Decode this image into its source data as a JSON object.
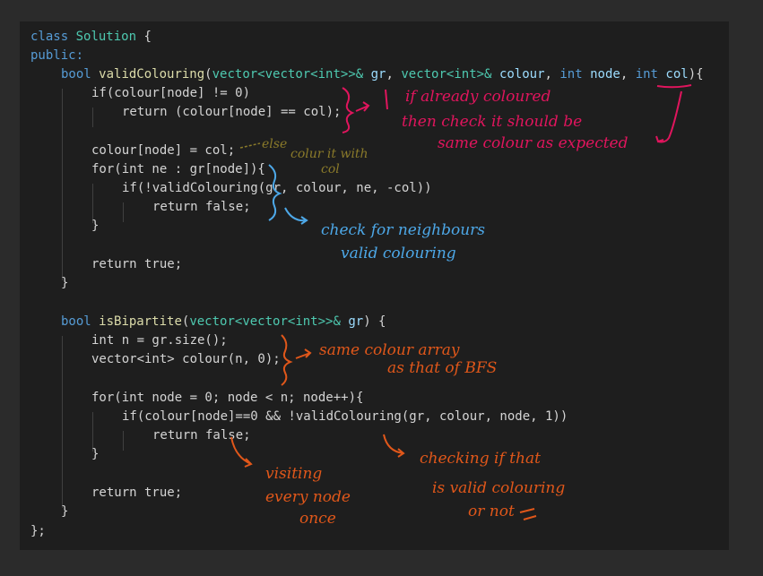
{
  "code": {
    "class_kw": "class",
    "class_name": "Solution",
    "public_label": "public:",
    "valid": {
      "ret_type": "bool",
      "name": "validColouring",
      "params": [
        {
          "type": "vector<vector<int>>&",
          "name": "gr"
        },
        {
          "type": "vector<int>&",
          "name": "colour"
        },
        {
          "type": "int",
          "name": "node"
        },
        {
          "type": "int",
          "name": "col"
        }
      ],
      "if_line": "if(colour[node] != 0)",
      "return_line": "return (colour[node] == col);",
      "assign_line": "colour[node] = col;",
      "for_line": "for(int ne : gr[node]){",
      "inner_if": "if(!validColouring(gr, colour, ne, -col))",
      "inner_return": "return false;",
      "final_return": "return true;"
    },
    "bip": {
      "ret_type": "bool",
      "name": "isBipartite",
      "decl_n": "int n = gr.size();",
      "decl_vec": "vector<int> colour(n, 0);",
      "for_line": "for(int node = 0; node < n; node++){",
      "inner_if": "if(colour[node]==0 && !validColouring(gr, colour, node, 1))",
      "inner_return": "return false;",
      "final_return": "return true;"
    }
  },
  "annotations": {
    "pink_1": "if already coloured",
    "pink_2": "then check it should be",
    "pink_3": "same colour as expected",
    "else_note": "else",
    "colour_it_1": "colur it with",
    "colour_it_2": "col",
    "blue_1": "check for neighbours",
    "blue_2": "valid colouring",
    "orange_same_1": "same colour array",
    "orange_same_2": "as that of BFS",
    "orange_visit_1": "visiting",
    "orange_visit_2": "every node",
    "orange_visit_3": "once",
    "orange_check_1": "checking if that",
    "orange_check_2": "is valid colouring",
    "orange_check_3": "or not"
  },
  "colors": {
    "background": "#2b2b2b",
    "editor": "#1e1e1e",
    "pink_ink": "#e0155d",
    "blue_ink": "#4da8e8",
    "orange_ink": "#e0571a"
  }
}
